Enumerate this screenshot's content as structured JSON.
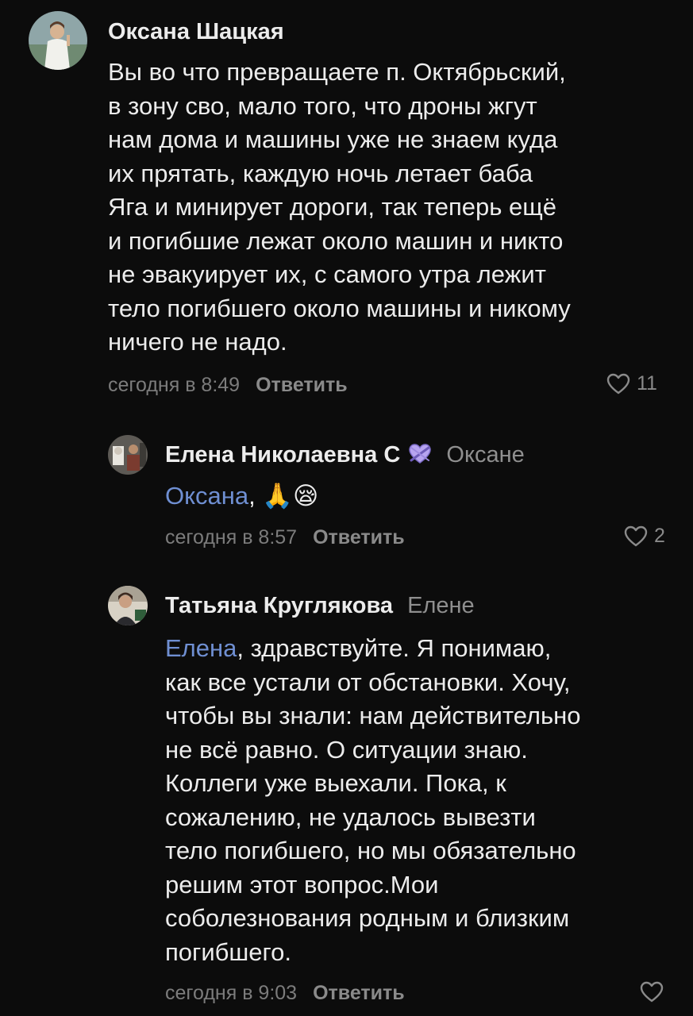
{
  "comments": [
    {
      "author": "Оксана Шацкая",
      "reply_to": "",
      "mention": "",
      "text": "Вы во что превращаете п. Октябрьский,\nв зону сво, мало того, что дроны жгут\nнам дома и машины уже не знаем куда\nих прятать, каждую ночь летает баба\nЯга и минирует дороги, так теперь ещё\nи погибшие лежат около машин и никто\nне эвакуирует их, с самого утра лежит\nтело погибшего около машины и никому\nничего не надо.",
      "time": "сегодня в 8:49",
      "reply_label": "Ответить",
      "likes": "11"
    },
    {
      "author": "Елена Николаевна С",
      "reply_to": "Оксане",
      "mention": "Оксана",
      "text": ", 🙏😪",
      "time": "сегодня в 8:57",
      "reply_label": "Ответить",
      "likes": "2"
    },
    {
      "author": "Татьяна Круглякова",
      "reply_to": "Елене",
      "mention": "Елена",
      "text": ", здравствуйте. Я понимаю,\nкак все устали от обстановки. Хочу,\nчтобы вы знали: нам действительно\nне всё равно. О ситуации знаю.\nКоллеги уже выехали. Пока, к\nсожалению, не удалось вывезти\nтело погибшего, но мы обязательно\nрешим этот вопрос.Мои\nсоболезнования родным и близким\nпогибшего.",
      "time": "сегодня в 9:03",
      "reply_label": "Ответить",
      "likes": ""
    }
  ]
}
